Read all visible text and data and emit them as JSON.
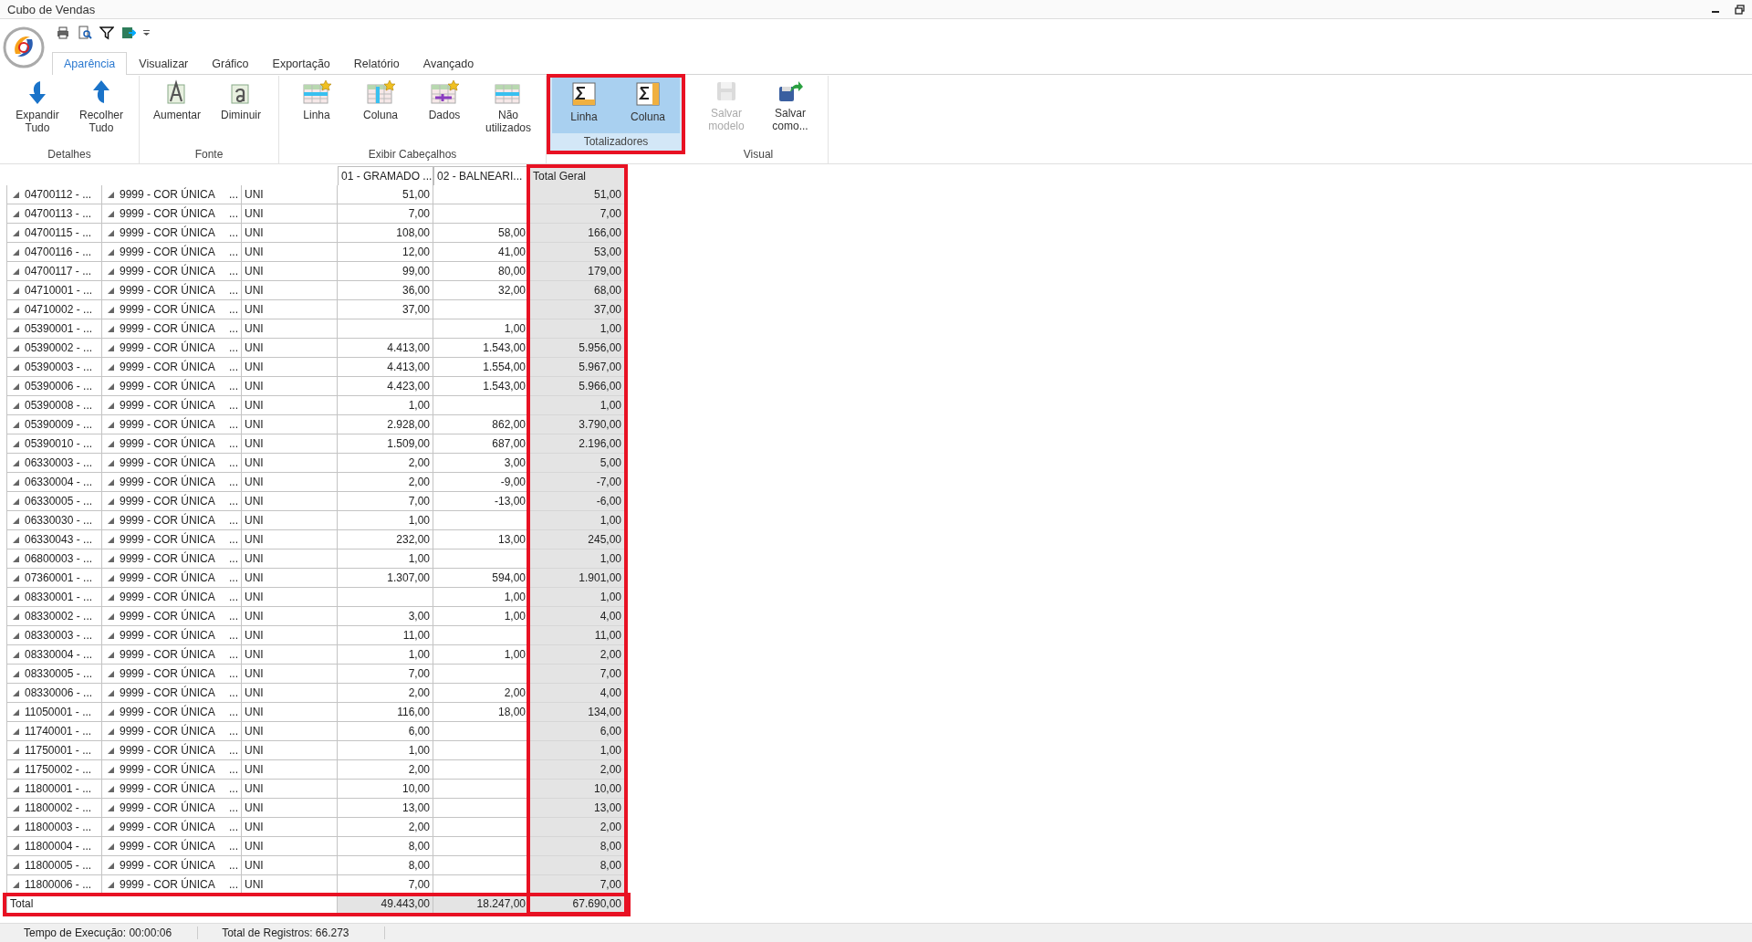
{
  "window": {
    "title": "Cubo de Vendas"
  },
  "tabs": [
    {
      "label": "Aparência",
      "selected": true
    },
    {
      "label": "Visualizar",
      "selected": false
    },
    {
      "label": "Gráfico",
      "selected": false
    },
    {
      "label": "Exportação",
      "selected": false
    },
    {
      "label": "Relatório",
      "selected": false
    },
    {
      "label": "Avançado",
      "selected": false
    }
  ],
  "ribbon_groups": [
    {
      "label": "Detalhes",
      "buttons": [
        {
          "kind": "expand",
          "label": "Expandir Tudo",
          "disabled": false,
          "selected": false
        },
        {
          "kind": "collapse",
          "label": "Recolher Tudo",
          "disabled": false,
          "selected": false
        }
      ]
    },
    {
      "label": "Fonte",
      "buttons": [
        {
          "kind": "font-up",
          "label": "Aumentar",
          "disabled": false,
          "selected": false
        },
        {
          "kind": "font-down",
          "label": "Diminuir",
          "disabled": false,
          "selected": false
        }
      ]
    },
    {
      "label": "Exibir Cabeçalhos",
      "buttons": [
        {
          "kind": "row-header",
          "label": "Linha",
          "disabled": false,
          "selected": false
        },
        {
          "kind": "col-header",
          "label": "Coluna",
          "disabled": false,
          "selected": false
        },
        {
          "kind": "data-header",
          "label": "Dados",
          "disabled": false,
          "selected": false
        },
        {
          "kind": "unused",
          "label": "Não utilizados",
          "disabled": false,
          "selected": false
        }
      ]
    },
    {
      "label": "Totalizadores",
      "highlighted": true,
      "buttons": [
        {
          "kind": "row-total",
          "label": "Linha",
          "disabled": false,
          "selected": true
        },
        {
          "kind": "col-total",
          "label": "Coluna",
          "disabled": false,
          "selected": true
        }
      ]
    },
    {
      "label": "Visual",
      "buttons": [
        {
          "kind": "save",
          "label": "Salvar modelo",
          "disabled": true,
          "selected": false
        },
        {
          "kind": "save-as",
          "label": "Salvar como...",
          "disabled": false,
          "selected": false
        }
      ]
    }
  ],
  "table": {
    "columns": [
      {
        "label": "01 - GRAMADO ...",
        "highlighted": false
      },
      {
        "label": "02 - BALNEARI...",
        "highlighted": false
      },
      {
        "label": "Total Geral",
        "highlighted": true
      }
    ],
    "rows": [
      {
        "product": "04700112 - ...",
        "variant": "9999 - COR ÚNICA",
        "more": "...",
        "unit": "UNI",
        "gramado": "51,00",
        "total_geral": "51,00"
      },
      {
        "product": "04700113 - ...",
        "variant": "9999 - COR ÚNICA",
        "more": "...",
        "unit": "UNI",
        "gramado": "7,00",
        "total_geral": "7,00"
      },
      {
        "product": "04700115 - ...",
        "variant": "9999 - COR ÚNICA",
        "more": "...",
        "unit": "UNI",
        "gramado": "108,00",
        "balneario": "58,00",
        "total_geral": "166,00"
      },
      {
        "product": "04700116 - ...",
        "variant": "9999 - COR ÚNICA",
        "more": "...",
        "unit": "UNI",
        "gramado": "12,00",
        "balneario": "41,00",
        "total_geral": "53,00"
      },
      {
        "product": "04700117 - ...",
        "variant": "9999 - COR ÚNICA",
        "more": "...",
        "unit": "UNI",
        "gramado": "99,00",
        "balneario": "80,00",
        "total_geral": "179,00"
      },
      {
        "product": "04710001 - ...",
        "variant": "9999 - COR ÚNICA",
        "more": "...",
        "unit": "UNI",
        "gramado": "36,00",
        "balneario": "32,00",
        "total_geral": "68,00"
      },
      {
        "product": "04710002 - ...",
        "variant": "9999 - COR ÚNICA",
        "more": "...",
        "unit": "UNI",
        "gramado": "37,00",
        "total_geral": "37,00"
      },
      {
        "product": "05390001 - ...",
        "variant": "9999 - COR ÚNICA",
        "more": "...",
        "unit": "UNI",
        "balneario": "1,00",
        "total_geral": "1,00"
      },
      {
        "product": "05390002 - ...",
        "variant": "9999 - COR ÚNICA",
        "more": "...",
        "unit": "UNI",
        "gramado": "4.413,00",
        "balneario": "1.543,00",
        "total_geral": "5.956,00"
      },
      {
        "product": "05390003 - ...",
        "variant": "9999 - COR ÚNICA",
        "more": "...",
        "unit": "UNI",
        "gramado": "4.413,00",
        "balneario": "1.554,00",
        "total_geral": "5.967,00"
      },
      {
        "product": "05390006 - ...",
        "variant": "9999 - COR ÚNICA",
        "more": "...",
        "unit": "UNI",
        "gramado": "4.423,00",
        "balneario": "1.543,00",
        "total_geral": "5.966,00"
      },
      {
        "product": "05390008 - ...",
        "variant": "9999 - COR ÚNICA",
        "more": "...",
        "unit": "UNI",
        "gramado": "1,00",
        "total_geral": "1,00"
      },
      {
        "product": "05390009 - ...",
        "variant": "9999 - COR ÚNICA",
        "more": "...",
        "unit": "UNI",
        "gramado": "2.928,00",
        "balneario": "862,00",
        "total_geral": "3.790,00"
      },
      {
        "product": "05390010 - ...",
        "variant": "9999 - COR ÚNICA",
        "more": "...",
        "unit": "UNI",
        "gramado": "1.509,00",
        "balneario": "687,00",
        "total_geral": "2.196,00"
      },
      {
        "product": "06330003 - ...",
        "variant": "9999 - COR ÚNICA",
        "more": "...",
        "unit": "UNI",
        "gramado": "2,00",
        "balneario": "3,00",
        "total_geral": "5,00"
      },
      {
        "product": "06330004 - ...",
        "variant": "9999 - COR ÚNICA",
        "more": "...",
        "unit": "UNI",
        "gramado": "2,00",
        "balneario": "-9,00",
        "total_geral": "-7,00"
      },
      {
        "product": "06330005 - ...",
        "variant": "9999 - COR ÚNICA",
        "more": "...",
        "unit": "UNI",
        "gramado": "7,00",
        "balneario": "-13,00",
        "total_geral": "-6,00"
      },
      {
        "product": "06330030 - ...",
        "variant": "9999 - COR ÚNICA",
        "more": "...",
        "unit": "UNI",
        "gramado": "1,00",
        "total_geral": "1,00"
      },
      {
        "product": "06330043 - ...",
        "variant": "9999 - COR ÚNICA",
        "more": "...",
        "unit": "UNI",
        "gramado": "232,00",
        "balneario": "13,00",
        "total_geral": "245,00"
      },
      {
        "product": "06800003 - ...",
        "variant": "9999 - COR ÚNICA",
        "more": "...",
        "unit": "UNI",
        "gramado": "1,00",
        "total_geral": "1,00"
      },
      {
        "product": "07360001 - ...",
        "variant": "9999 - COR ÚNICA",
        "more": "...",
        "unit": "UNI",
        "gramado": "1.307,00",
        "balneario": "594,00",
        "total_geral": "1.901,00"
      },
      {
        "product": "08330001 - ...",
        "variant": "9999 - COR ÚNICA",
        "more": "...",
        "unit": "UNI",
        "balneario": "1,00",
        "total_geral": "1,00"
      },
      {
        "product": "08330002 - ...",
        "variant": "9999 - COR ÚNICA",
        "more": "...",
        "unit": "UNI",
        "gramado": "3,00",
        "balneario": "1,00",
        "total_geral": "4,00"
      },
      {
        "product": "08330003 - ...",
        "variant": "9999 - COR ÚNICA",
        "more": "...",
        "unit": "UNI",
        "gramado": "11,00",
        "total_geral": "11,00"
      },
      {
        "product": "08330004 - ...",
        "variant": "9999 - COR ÚNICA",
        "more": "...",
        "unit": "UNI",
        "gramado": "1,00",
        "balneario": "1,00",
        "total_geral": "2,00"
      },
      {
        "product": "08330005 - ...",
        "variant": "9999 - COR ÚNICA",
        "more": "...",
        "unit": "UNI",
        "gramado": "7,00",
        "total_geral": "7,00"
      },
      {
        "product": "08330006 - ...",
        "variant": "9999 - COR ÚNICA",
        "more": "...",
        "unit": "UNI",
        "gramado": "2,00",
        "balneario": "2,00",
        "total_geral": "4,00"
      },
      {
        "product": "11050001 - ...",
        "variant": "9999 - COR ÚNICA",
        "more": "...",
        "unit": "UNI",
        "gramado": "116,00",
        "balneario": "18,00",
        "total_geral": "134,00"
      },
      {
        "product": "11740001 - ...",
        "variant": "9999 - COR ÚNICA",
        "more": "...",
        "unit": "UNI",
        "gramado": "6,00",
        "total_geral": "6,00"
      },
      {
        "product": "11750001 - ...",
        "variant": "9999 - COR ÚNICA",
        "more": "...",
        "unit": "UNI",
        "gramado": "1,00",
        "total_geral": "1,00"
      },
      {
        "product": "11750002 - ...",
        "variant": "9999 - COR ÚNICA",
        "more": "...",
        "unit": "UNI",
        "gramado": "2,00",
        "total_geral": "2,00"
      },
      {
        "product": "11800001 - ...",
        "variant": "9999 - COR ÚNICA",
        "more": "...",
        "unit": "UNI",
        "gramado": "10,00",
        "total_geral": "10,00"
      },
      {
        "product": "11800002 - ...",
        "variant": "9999 - COR ÚNICA",
        "more": "...",
        "unit": "UNI",
        "gramado": "13,00",
        "total_geral": "13,00"
      },
      {
        "product": "11800003 - ...",
        "variant": "9999 - COR ÚNICA",
        "more": "...",
        "unit": "UNI",
        "gramado": "2,00",
        "total_geral": "2,00"
      },
      {
        "product": "11800004 - ...",
        "variant": "9999 - COR ÚNICA",
        "more": "...",
        "unit": "UNI",
        "gramado": "8,00",
        "total_geral": "8,00"
      },
      {
        "product": "11800005 - ...",
        "variant": "9999 - COR ÚNICA",
        "more": "...",
        "unit": "UNI",
        "gramado": "8,00",
        "total_geral": "8,00"
      },
      {
        "product": "11800006 - ...",
        "variant": "9999 - COR ÚNICA",
        "more": "...",
        "unit": "UNI",
        "gramado": "7,00",
        "total_geral": "7,00"
      }
    ],
    "total_row": {
      "label": "Total",
      "values": [
        "49.443,00",
        "18.247,00",
        "67.690,00"
      ],
      "highlighted": true
    }
  },
  "status_bar": [
    "Tempo de Execução: 00:00:06",
    "Total de Registros: 66.273"
  ]
}
